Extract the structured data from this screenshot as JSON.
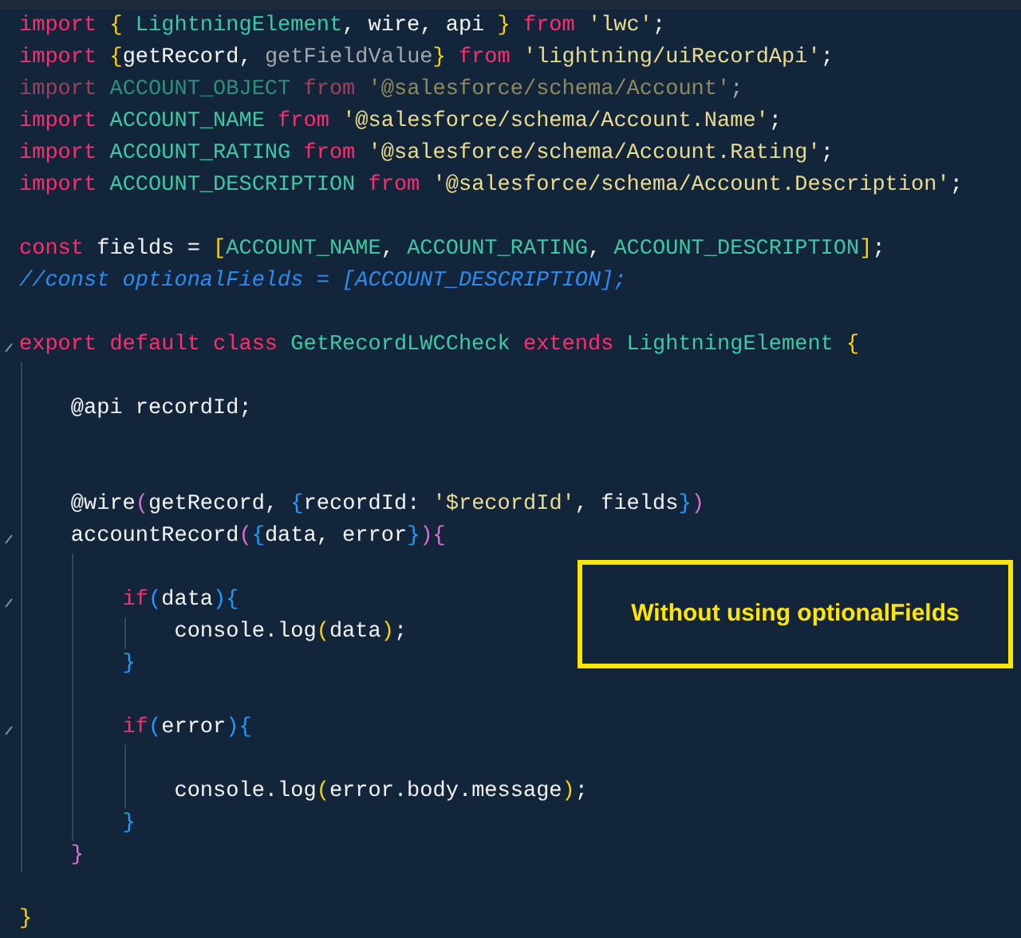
{
  "editor": {
    "lines": [
      {
        "kind": "code",
        "fold": false,
        "tokens": [
          {
            "t": "import ",
            "kind": "kw"
          },
          {
            "t": "{ ",
            "kind": "b1"
          },
          {
            "t": "LightningElement",
            "kind": "cls"
          },
          {
            "t": ", wire, api ",
            "kind": "pl"
          },
          {
            "t": "} ",
            "kind": "b1"
          },
          {
            "t": "from ",
            "kind": "kw"
          },
          {
            "t": "'lwc'",
            "kind": "str"
          },
          {
            "t": ";",
            "kind": "pl"
          }
        ]
      },
      {
        "kind": "code",
        "fold": false,
        "tokens": [
          {
            "t": "import ",
            "kind": "kw"
          },
          {
            "t": "{",
            "kind": "b1"
          },
          {
            "t": "getRecord, ",
            "kind": "pl"
          },
          {
            "t": "getFieldValue",
            "kind": "dim"
          },
          {
            "t": "} ",
            "kind": "b1"
          },
          {
            "t": "from ",
            "kind": "kw"
          },
          {
            "t": "'lightning/uiRecordApi'",
            "kind": "str"
          },
          {
            "t": ";",
            "kind": "pl"
          }
        ]
      },
      {
        "kind": "code",
        "fold": false,
        "tokens": [
          {
            "t": "import ",
            "kind": "dkw"
          },
          {
            "t": "ACCOUNT_OBJECT ",
            "kind": "dcls"
          },
          {
            "t": "from ",
            "kind": "dkw"
          },
          {
            "t": "'@salesforce/schema/Account'",
            "kind": "dstr"
          },
          {
            "t": ";",
            "kind": "dim"
          }
        ]
      },
      {
        "kind": "code",
        "fold": false,
        "tokens": [
          {
            "t": "import ",
            "kind": "kw"
          },
          {
            "t": "ACCOUNT_NAME ",
            "kind": "cls"
          },
          {
            "t": "from ",
            "kind": "kw"
          },
          {
            "t": "'@salesforce/schema/Account.Name'",
            "kind": "str"
          },
          {
            "t": ";",
            "kind": "pl"
          }
        ]
      },
      {
        "kind": "code",
        "fold": false,
        "tokens": [
          {
            "t": "import ",
            "kind": "kw"
          },
          {
            "t": "ACCOUNT_RATING ",
            "kind": "cls"
          },
          {
            "t": "from ",
            "kind": "kw"
          },
          {
            "t": "'@salesforce/schema/Account.Rating'",
            "kind": "str"
          },
          {
            "t": ";",
            "kind": "pl"
          }
        ]
      },
      {
        "kind": "code",
        "fold": false,
        "tokens": [
          {
            "t": "import ",
            "kind": "kw"
          },
          {
            "t": "ACCOUNT_DESCRIPTION ",
            "kind": "cls"
          },
          {
            "t": "from ",
            "kind": "kw"
          },
          {
            "t": "'@salesforce/schema/Account.Description'",
            "kind": "str"
          },
          {
            "t": ";",
            "kind": "pl"
          }
        ]
      },
      {
        "kind": "blank",
        "fold": false
      },
      {
        "kind": "code",
        "fold": false,
        "tokens": [
          {
            "t": "const ",
            "kind": "kw"
          },
          {
            "t": "fields = ",
            "kind": "pl"
          },
          {
            "t": "[",
            "kind": "b1"
          },
          {
            "t": "ACCOUNT_NAME",
            "kind": "cls"
          },
          {
            "t": ", ",
            "kind": "pl"
          },
          {
            "t": "ACCOUNT_RATING",
            "kind": "cls"
          },
          {
            "t": ", ",
            "kind": "pl"
          },
          {
            "t": "ACCOUNT_DESCRIPTION",
            "kind": "cls"
          },
          {
            "t": "]",
            "kind": "b1"
          },
          {
            "t": ";",
            "kind": "pl"
          }
        ]
      },
      {
        "kind": "code",
        "fold": false,
        "tokens": [
          {
            "t": "//const optionalFields = [ACCOUNT_DESCRIPTION];",
            "kind": "cmt"
          }
        ]
      },
      {
        "kind": "blank",
        "fold": false
      },
      {
        "kind": "code",
        "fold": true,
        "tokens": [
          {
            "t": "export default class ",
            "kind": "kw"
          },
          {
            "t": "GetRecordLWCCheck ",
            "kind": "cls"
          },
          {
            "t": "extends ",
            "kind": "kw"
          },
          {
            "t": "LightningElement ",
            "kind": "cls"
          },
          {
            "t": "{",
            "kind": "b1"
          }
        ]
      },
      {
        "kind": "blank",
        "fold": false
      },
      {
        "kind": "code",
        "fold": false,
        "tokens": [
          {
            "t": "    @api recordId;",
            "kind": "pl"
          }
        ]
      },
      {
        "kind": "blank",
        "fold": false
      },
      {
        "kind": "blank",
        "fold": false
      },
      {
        "kind": "code",
        "fold": false,
        "tokens": [
          {
            "t": "    @wire",
            "kind": "pl"
          },
          {
            "t": "(",
            "kind": "b2"
          },
          {
            "t": "getRecord, ",
            "kind": "pl"
          },
          {
            "t": "{",
            "kind": "b3"
          },
          {
            "t": "recordId: ",
            "kind": "pl"
          },
          {
            "t": "'$recordId'",
            "kind": "str"
          },
          {
            "t": ", fields",
            "kind": "pl"
          },
          {
            "t": "}",
            "kind": "b3"
          },
          {
            "t": ")",
            "kind": "b2"
          }
        ]
      },
      {
        "kind": "code",
        "fold": true,
        "tokens": [
          {
            "t": "    accountRecord",
            "kind": "pl"
          },
          {
            "t": "(",
            "kind": "b2"
          },
          {
            "t": "{",
            "kind": "b3"
          },
          {
            "t": "data, error",
            "kind": "pl"
          },
          {
            "t": "}",
            "kind": "b3"
          },
          {
            "t": ")",
            "kind": "b2"
          },
          {
            "t": "{",
            "kind": "b2"
          }
        ]
      },
      {
        "kind": "blank",
        "fold": false
      },
      {
        "kind": "code",
        "fold": true,
        "tokens": [
          {
            "t": "        if",
            "kind": "kw"
          },
          {
            "t": "(",
            "kind": "b3"
          },
          {
            "t": "data",
            "kind": "pl"
          },
          {
            "t": ")",
            "kind": "b3"
          },
          {
            "t": "{",
            "kind": "b3"
          }
        ]
      },
      {
        "kind": "code",
        "fold": false,
        "tokens": [
          {
            "t": "            console.log",
            "kind": "pl"
          },
          {
            "t": "(",
            "kind": "b1"
          },
          {
            "t": "data",
            "kind": "pl"
          },
          {
            "t": ")",
            "kind": "b1"
          },
          {
            "t": ";",
            "kind": "pl"
          }
        ]
      },
      {
        "kind": "code",
        "fold": false,
        "tokens": [
          {
            "t": "        }",
            "kind": "b3"
          }
        ]
      },
      {
        "kind": "blank",
        "fold": false
      },
      {
        "kind": "code",
        "fold": true,
        "tokens": [
          {
            "t": "        if",
            "kind": "kw"
          },
          {
            "t": "(",
            "kind": "b3"
          },
          {
            "t": "error",
            "kind": "pl"
          },
          {
            "t": ")",
            "kind": "b3"
          },
          {
            "t": "{",
            "kind": "b3"
          }
        ]
      },
      {
        "kind": "blank",
        "fold": false
      },
      {
        "kind": "code",
        "fold": false,
        "tokens": [
          {
            "t": "            console.log",
            "kind": "pl"
          },
          {
            "t": "(",
            "kind": "b1"
          },
          {
            "t": "error.body.message",
            "kind": "pl"
          },
          {
            "t": ")",
            "kind": "b1"
          },
          {
            "t": ";",
            "kind": "pl"
          }
        ]
      },
      {
        "kind": "code",
        "fold": false,
        "tokens": [
          {
            "t": "        }",
            "kind": "b3"
          }
        ]
      },
      {
        "kind": "code",
        "fold": false,
        "tokens": [
          {
            "t": "    }",
            "kind": "b2"
          }
        ]
      },
      {
        "kind": "blank",
        "fold": false
      },
      {
        "kind": "code",
        "fold": false,
        "tokens": [
          {
            "t": "}",
            "kind": "b1"
          }
        ]
      }
    ]
  },
  "annotation": {
    "text": "Without using optionalFields"
  }
}
